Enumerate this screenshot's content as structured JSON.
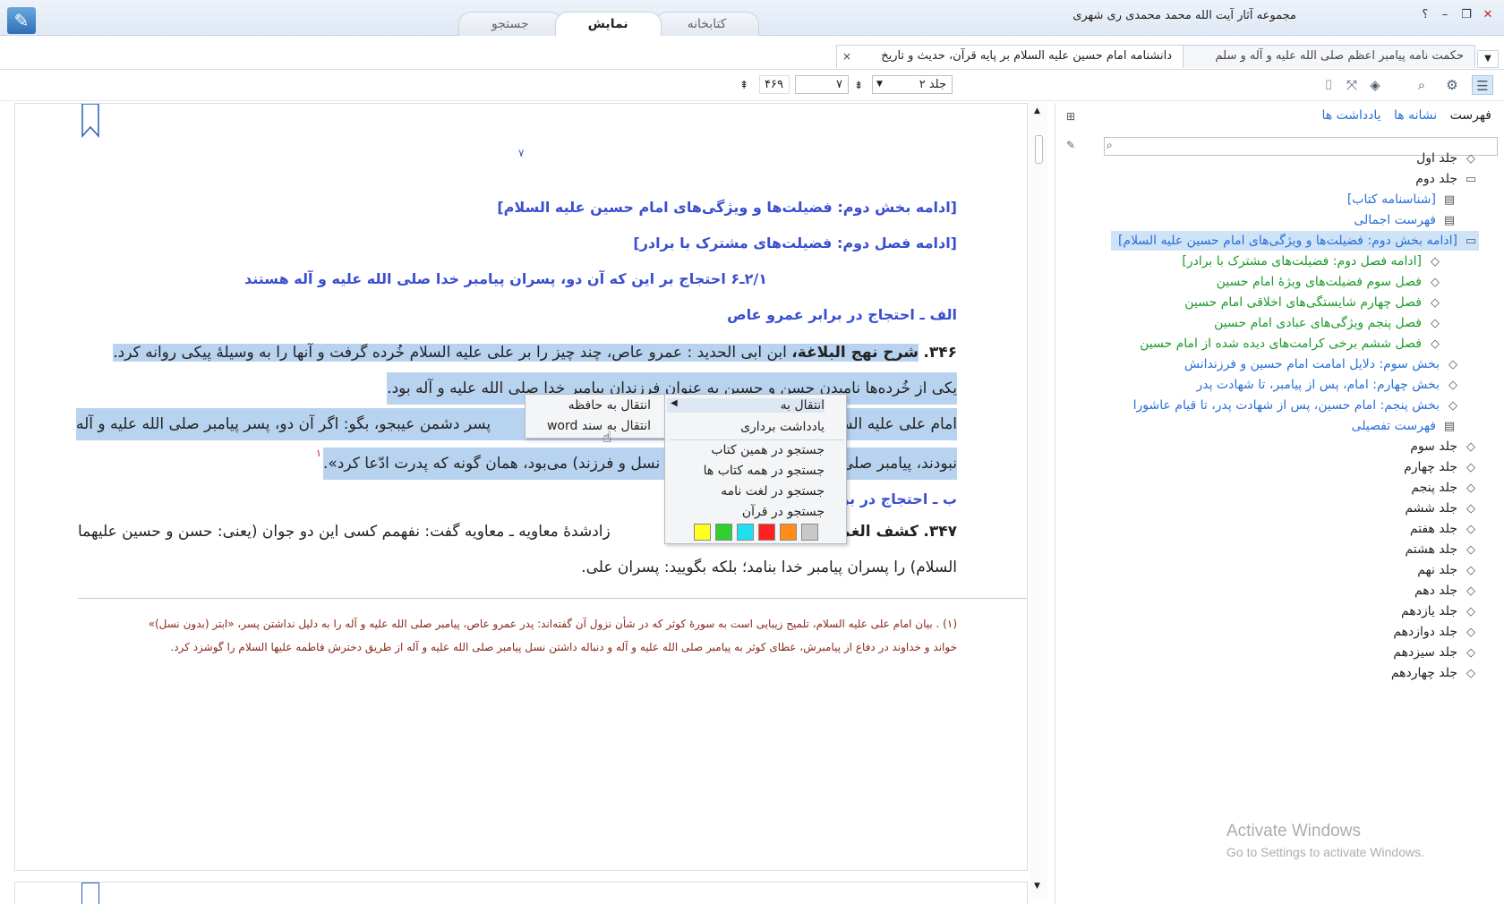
{
  "window": {
    "title": "مجموعه آثار آیت الله محمد محمدی ری شهری",
    "help_label": "؟",
    "min_label": "–",
    "max_label": "❐",
    "close_label": "✕"
  },
  "main_tabs": [
    {
      "label": "کتابخانه"
    },
    {
      "label": "نمایش",
      "active": true
    },
    {
      "label": "جستجو"
    }
  ],
  "doc_tabs": [
    {
      "label": "حکمت نامه پیامبر اعظم صلی الله علیه و آله و سلم"
    },
    {
      "label": "دانشنامه امام حسین علیه السلام بر پایه قرآن، حدیث و تاریخ",
      "active": true
    }
  ],
  "toolbar": {
    "volume": "جلد ۲",
    "page": "۷",
    "total_pages": "۴۶۹"
  },
  "document": {
    "page_number": "۷",
    "headings": [
      "[ادامه بخش دوم: فضیلت‌ها و ویژگی‌های امام حسین علیه السلام]",
      "[ادامه فصل دوم: فضیلت‌های مشترک با برادر]",
      "۲/۱ـ۶ احتجاج بر این که آن دو، پسران پیامبر خدا صلی الله علیه و آله هستند",
      "الف ـ احتجاج در برابر عمرو عاص"
    ],
    "p346_num": "۳۴۶.",
    "p346_src": "شرح نهج البلاغة،",
    "p346_line1": "ابن ابی الحدید : عمرو عاص، چند چیز را بر علی علیه السلام خُرده گرفت و آنها را به وسیلۀ پیکی روانه کرد.",
    "p346_line2": "یکی از خُرده‌ها نامیدن حسن و حسین به عنوان فرزندان پیامبر خدا صلی الله علیه و آله بود.",
    "p346_line3a": "امام علی علیه السلام",
    "p346_line3b": "پسر دشمن عیبجو، بگو: اگر آن دو، پسر پیامبر صلی الله علیه و آله",
    "p346_line4a": "نبودند، پیامبر صلی",
    "p346_line4b": "نسل و فرزند) می‌بود، همان گونه که پدرت ادّعا کرد».",
    "footnote_mark": "۱",
    "heading_b": "ب ـ احتجاج در بر",
    "p347_num": "۳۴۷.",
    "p347_src": "کشف الغمة",
    "p347_line1": "زادشدۀ معاویه ـ معاویه گفت: نفهمم کسی این دو جوان (یعنی: حسن و حسین علیهما",
    "p347_line2": "السلام) را پسران پیامبر خدا بنامد؛ بلکه بگویید: پسران علی.",
    "footnote_line1": "(۱)  . بیان امام علی علیه السلام، تلمیح زیبایی است به سورۀ کوثر که در شأن نزول آن گفته‌اند: پدر عمرو عاص، پیامبر صلی الله علیه و آله را به دلیل نداشتن پسر، «ابتر (بدون نسل)»",
    "footnote_line2": "خواند و خداوند در دفاع از پیامبرش، عطای کوثر به پیامبر صلی الله علیه و آله و دنباله داشتن نسل پیامبر صلی الله علیه و آله از طریق دخترش فاطمه علیها السلام را گوشزد کرد."
  },
  "context_menu": {
    "items": [
      "انتقال به",
      "یادداشت برداری",
      "جستجو در همین کتاب",
      "جستجو در همه کتاب ها",
      "جستجو در لغت نامه",
      "جستجو در قرآن"
    ],
    "submenu": [
      "انتقال به حافظه",
      "انتقال به سند word"
    ],
    "colors": [
      "#c8c8c8",
      "#ff8c1a",
      "#ff2020",
      "#20e0f0",
      "#30d030",
      "#ffff20"
    ]
  },
  "side": {
    "tabs": [
      "فهرست",
      "نشانه ها",
      "یادداشت ها"
    ],
    "tree": [
      {
        "label": "جلد اول",
        "indent": 0,
        "color": "#222",
        "icon": "book-icon"
      },
      {
        "label": "جلد دوم",
        "indent": 0,
        "color": "#222",
        "icon": "book-open-icon"
      },
      {
        "label": "[شناسنامه کتاب]",
        "indent": 1,
        "color": "#2a6fd6",
        "icon": "page-icon"
      },
      {
        "label": "فهرست اجمالی",
        "indent": 1,
        "color": "#2a6fd6",
        "icon": "page-icon"
      },
      {
        "label": "[ادامه بخش دوم: فضیلت‌ها و ویژگی‌های امام حسین علیه السلام]",
        "indent": 1,
        "color": "#2a6fd6",
        "icon": "book-open-icon",
        "highlight": true
      },
      {
        "label": "[ادامه فصل دوم: فضیلت‌های مشترک با برادر]",
        "indent": 2,
        "color": "#1d9a2a",
        "icon": "book-icon"
      },
      {
        "label": "فصل سوم فضیلت‌های ویژۀ امام حسین",
        "indent": 2,
        "color": "#1d9a2a",
        "icon": "book-icon"
      },
      {
        "label": "فصل چهارم شایستگی‌های اخلاقی امام حسین",
        "indent": 2,
        "color": "#1d9a2a",
        "icon": "book-icon"
      },
      {
        "label": "فصل پنجم ویژگی‌های عبادی امام حسین",
        "indent": 2,
        "color": "#1d9a2a",
        "icon": "book-icon"
      },
      {
        "label": "فصل ششم برخی کرامت‌های دیده شده از امام حسین",
        "indent": 2,
        "color": "#1d9a2a",
        "icon": "book-icon"
      },
      {
        "label": "بخش سوم: دلایل امامت امام حسین و فرزندانش",
        "indent": 1,
        "color": "#2a6fd6",
        "icon": "book-icon"
      },
      {
        "label": "بخش چهارم: امام، پس از پیامبر، تا شهادت پدر",
        "indent": 1,
        "color": "#2a6fd6",
        "icon": "book-icon"
      },
      {
        "label": "بخش پنجم: امام حسین، پس از شهادت پدر، تا قیام عاشورا",
        "indent": 1,
        "color": "#2a6fd6",
        "icon": "book-icon"
      },
      {
        "label": "فهرست تفصیلی",
        "indent": 1,
        "color": "#2a6fd6",
        "icon": "page-icon"
      },
      {
        "label": "جلد سوم",
        "indent": 0,
        "color": "#222",
        "icon": "book-icon"
      },
      {
        "label": "جلد چهارم",
        "indent": 0,
        "color": "#222",
        "icon": "book-icon"
      },
      {
        "label": "جلد پنجم",
        "indent": 0,
        "color": "#222",
        "icon": "book-icon"
      },
      {
        "label": "جلد ششم",
        "indent": 0,
        "color": "#222",
        "icon": "book-icon"
      },
      {
        "label": "جلد هفتم",
        "indent": 0,
        "color": "#222",
        "icon": "book-icon"
      },
      {
        "label": "جلد هشتم",
        "indent": 0,
        "color": "#222",
        "icon": "book-icon"
      },
      {
        "label": "جلد نهم",
        "indent": 0,
        "color": "#222",
        "icon": "book-icon"
      },
      {
        "label": "جلد دهم",
        "indent": 0,
        "color": "#222",
        "icon": "book-icon"
      },
      {
        "label": "جلد یازدهم",
        "indent": 0,
        "color": "#222",
        "icon": "book-icon"
      },
      {
        "label": "جلد دوازدهم",
        "indent": 0,
        "color": "#222",
        "icon": "book-icon"
      },
      {
        "label": "جلد سیزدهم",
        "indent": 0,
        "color": "#222",
        "icon": "book-icon"
      },
      {
        "label": "جلد چهاردهم",
        "indent": 0,
        "color": "#222",
        "icon": "book-icon"
      }
    ]
  },
  "watermark": {
    "line1": "Activate Windows",
    "line2": "Go to Settings to activate Windows."
  }
}
